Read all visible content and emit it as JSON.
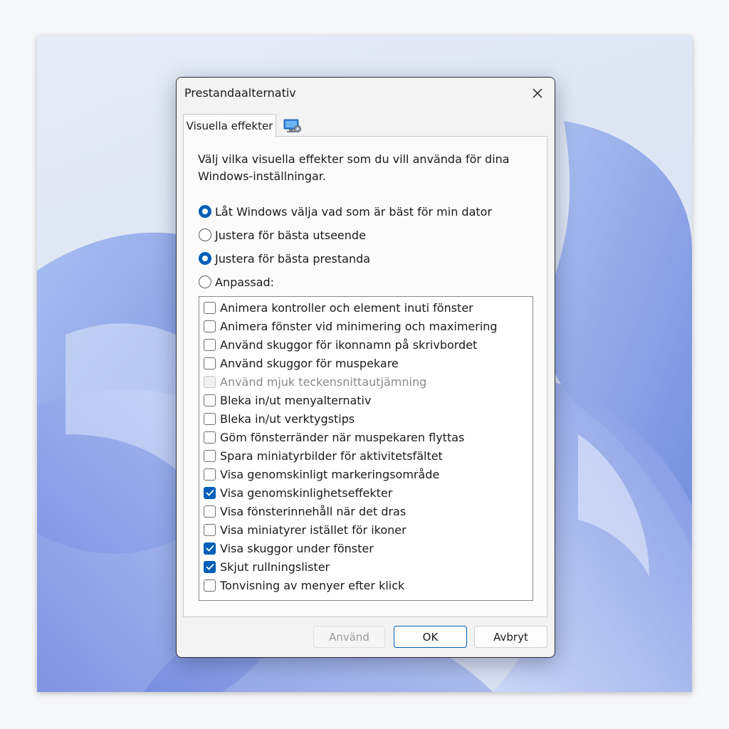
{
  "dialog": {
    "title": "Prestandaalternativ",
    "close_icon": "close-icon"
  },
  "tabs": [
    {
      "label": "Visuella effekter",
      "selected": true
    },
    {
      "icon": "monitor-settings-icon",
      "selected": false
    }
  ],
  "description": "Välj vilka visuella effekter som du vill använda för dina Windows-inställningar.",
  "radios": [
    {
      "label": "Låt Windows välja vad som är bäst för min dator",
      "selected": true
    },
    {
      "label": "Justera för bästa utseende",
      "selected": false
    },
    {
      "label": "Justera för bästa prestanda",
      "selected": true
    },
    {
      "label": "Anpassad:",
      "selected": false
    }
  ],
  "effects": [
    {
      "label": "Animera kontroller och element inuti fönster",
      "checked": false,
      "disabled": false
    },
    {
      "label": "Animera fönster vid minimering och maximering",
      "checked": false,
      "disabled": false
    },
    {
      "label": "Använd skuggor för ikonnamn på skrivbordet",
      "checked": false,
      "disabled": false
    },
    {
      "label": "Använd skuggor för muspekare",
      "checked": false,
      "disabled": false
    },
    {
      "label": "Använd mjuk teckensnittautjämning",
      "checked": false,
      "disabled": true
    },
    {
      "label": "Bleka in/ut menyalternativ",
      "checked": false,
      "disabled": false
    },
    {
      "label": "Bleka in/ut verktygstips",
      "checked": false,
      "disabled": false
    },
    {
      "label": "Göm fönsterränder när muspekaren flyttas",
      "checked": false,
      "disabled": false
    },
    {
      "label": "Spara miniatyrbilder för aktivitetsfältet",
      "checked": false,
      "disabled": false
    },
    {
      "label": "Visa genomskinligt markeringsområde",
      "checked": false,
      "disabled": false
    },
    {
      "label": "Visa genomskinlighetseffekter",
      "checked": true,
      "disabled": false
    },
    {
      "label": "Visa fönsterinnehåll när det dras",
      "checked": false,
      "disabled": false
    },
    {
      "label": "Visa miniatyrer istället för ikoner",
      "checked": false,
      "disabled": false
    },
    {
      "label": "Visa skuggor under fönster",
      "checked": true,
      "disabled": false
    },
    {
      "label": "Skjut rullningslister",
      "checked": true,
      "disabled": false
    },
    {
      "label": "Tonvisning av menyer efter klick",
      "checked": false,
      "disabled": false
    }
  ],
  "buttons": {
    "apply": "Använd",
    "ok": "OK",
    "cancel": "Avbryt"
  },
  "colors": {
    "accent": "#005fb8"
  }
}
